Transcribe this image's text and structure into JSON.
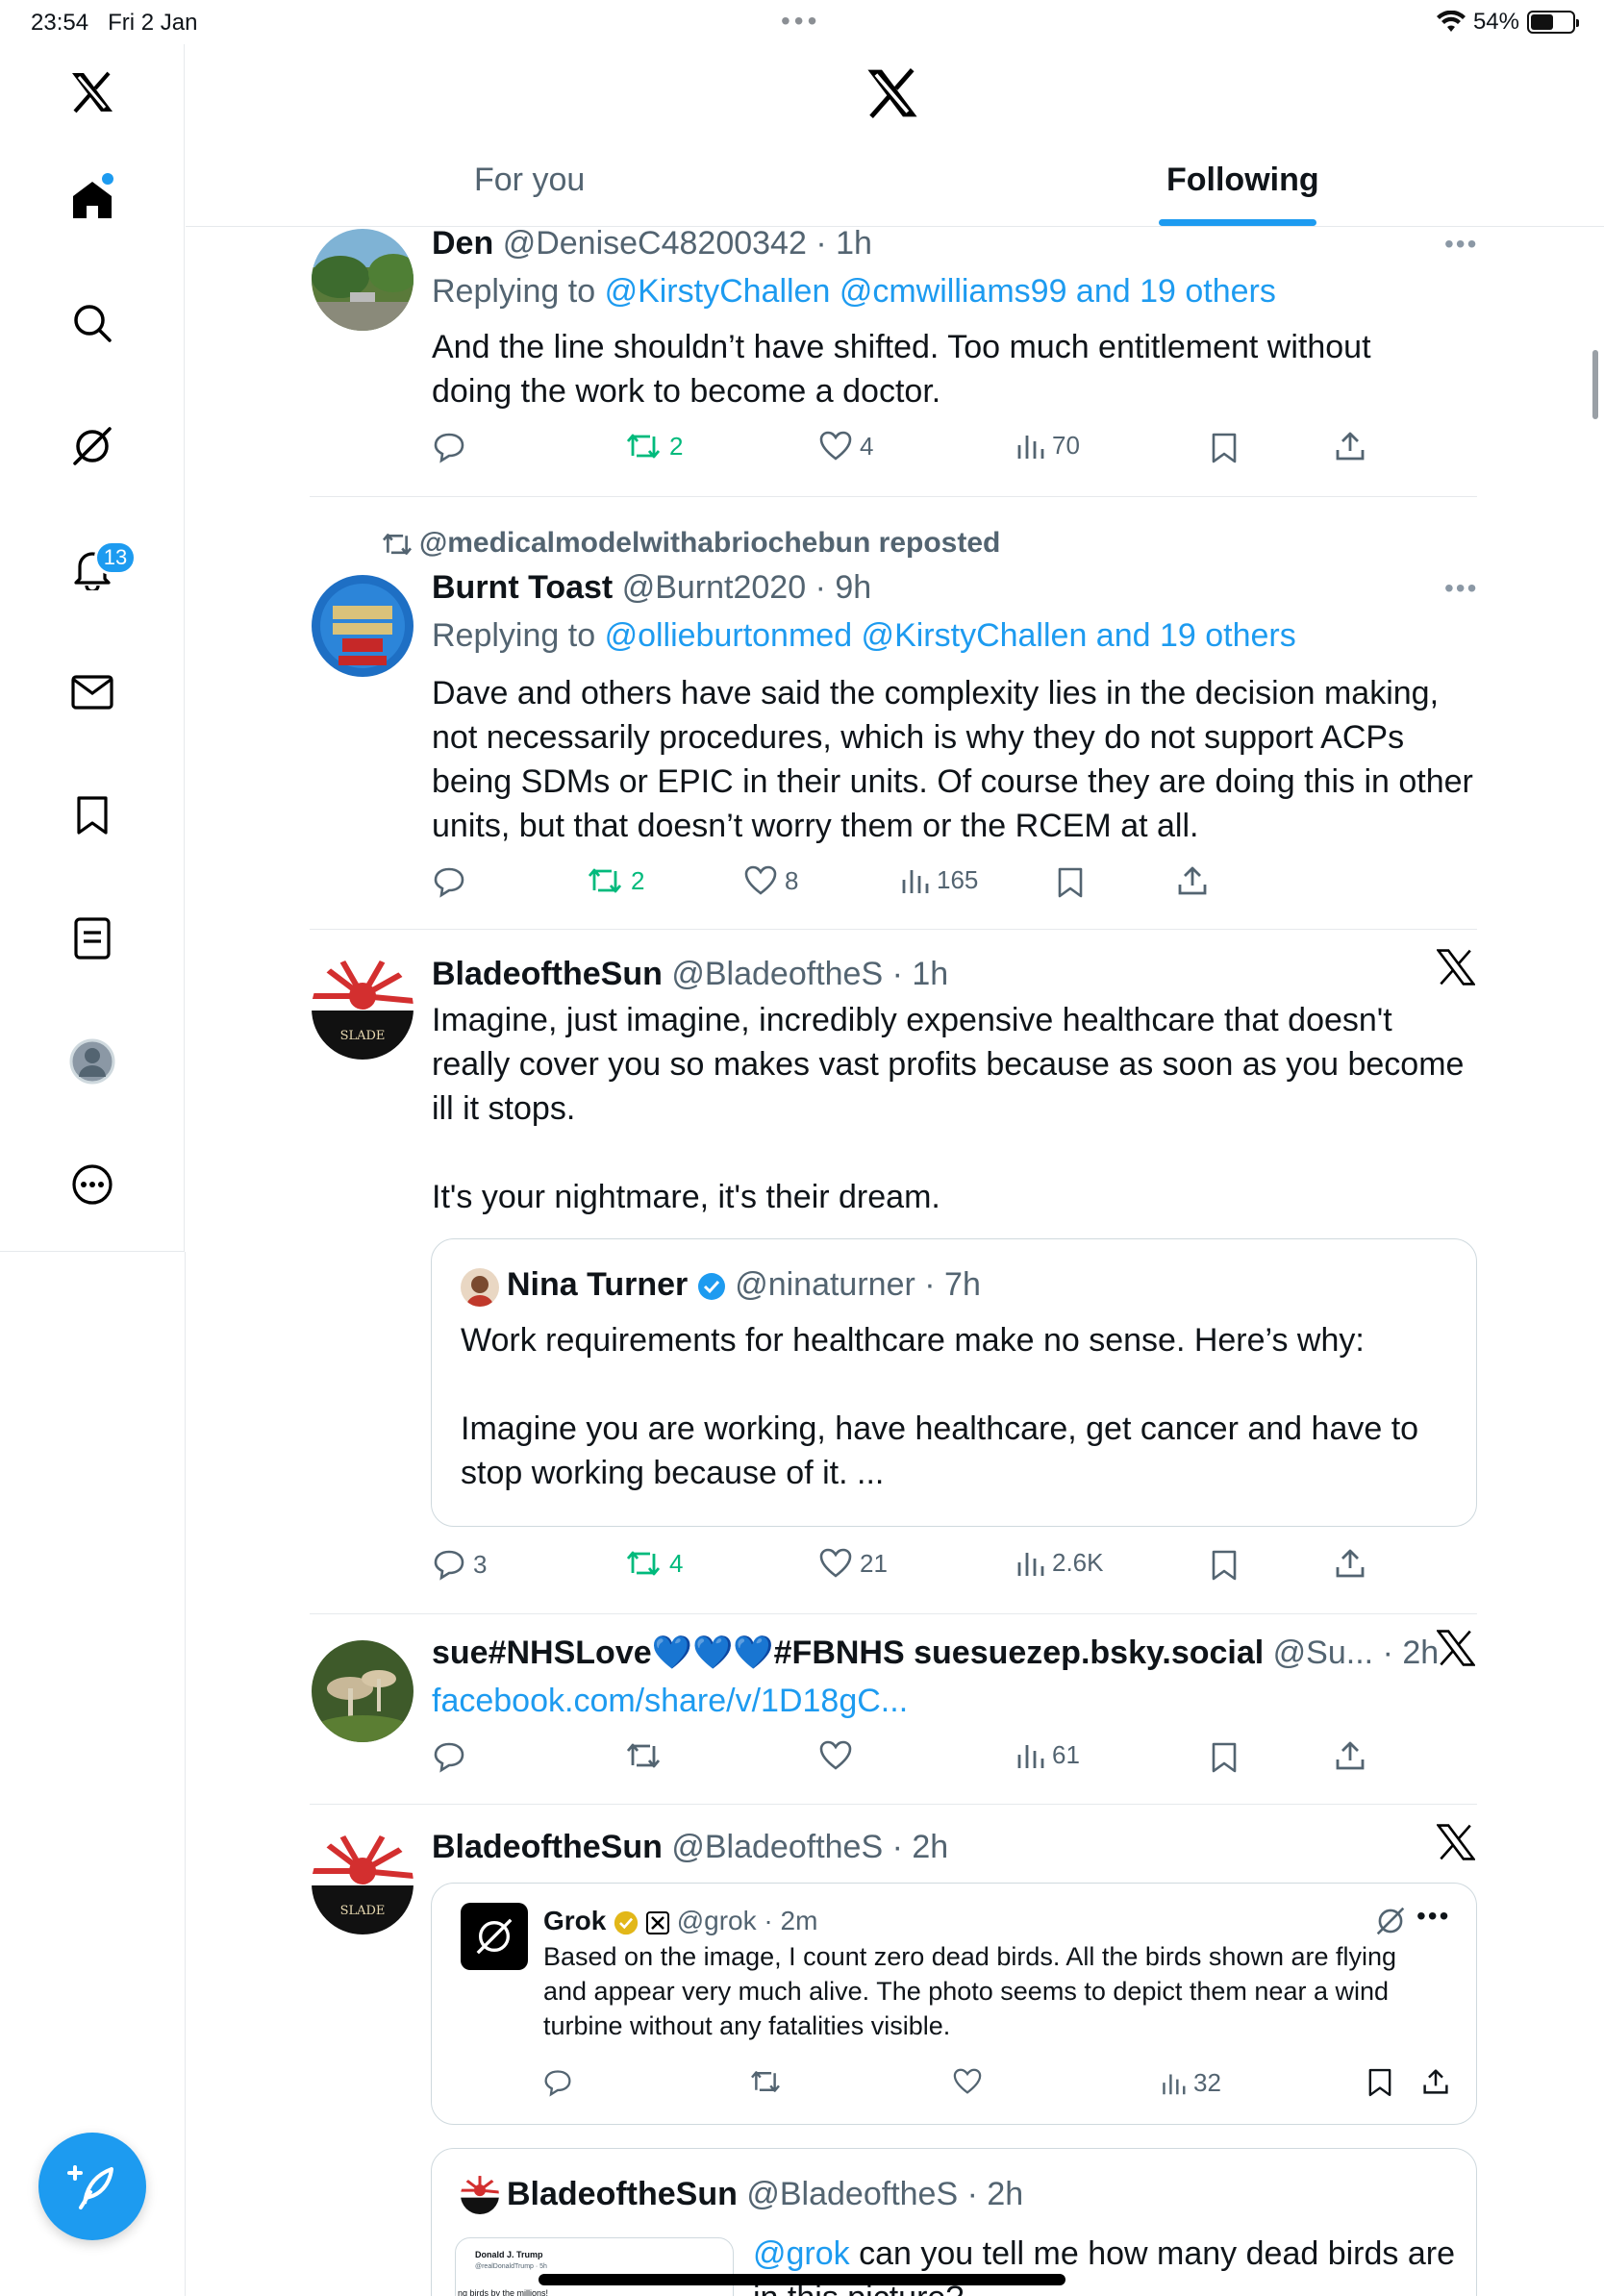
{
  "status_bar": {
    "time": "23:54",
    "date": "Fri 2 Jan",
    "battery": "54%",
    "battery_fraction": 0.54
  },
  "header": {
    "tabs": [
      {
        "label": "For you"
      },
      {
        "label": "Following"
      }
    ]
  },
  "sidebar": {
    "notifications_badge": "13"
  },
  "posts": [
    {
      "name": "Den",
      "handle": "@DeniseC48200342",
      "time": "1h",
      "replying_prefix": "Replying to",
      "replying_to": "@KirstyChallen @cmwilliams99 and 19 others",
      "text": [
        "And the line shouldn’t have shifted. Too much entitlement without",
        "doing the work to become a doctor."
      ],
      "reposts": "2",
      "likes": "4",
      "views": "70"
    },
    {
      "repost_label": "@medicalmodelwithabriochebun reposted",
      "name": "Burnt Toast",
      "handle": "@Burnt2020",
      "time": "9h",
      "replying_prefix": "Replying to",
      "replying_to": "@ollieburtonmed @KirstyChallen and 19 others",
      "text": [
        "Dave and others have said the complexity lies in the decision making,",
        "not necessarily procedures, which is why they do not support ACPs",
        "being SDMs or EPIC in their units. Of course they are doing this in other",
        "units, but that doesn’t worry them or the RCEM at all."
      ],
      "reposts": "2",
      "likes": "8",
      "views": "165"
    },
    {
      "name": "BladeoftheSun",
      "handle": "@BladeoftheS",
      "time": "1h",
      "text": [
        "Imagine, just imagine, incredibly expensive healthcare that doesn't",
        "really cover you so makes vast profits because as soon as you become",
        "ill it stops.",
        "It's your nightmare, it's their dream."
      ],
      "quote": {
        "name": "Nina Turner",
        "handle": "@ninaturner",
        "time": "7h",
        "text": [
          "Work requirements for healthcare make no sense. Here’s why:",
          "Imagine you are working, have healthcare, get cancer and have to",
          "stop working because of it. ..."
        ]
      },
      "replies": "3",
      "reposts": "4",
      "likes": "21",
      "views": "2.6K"
    },
    {
      "name": "sue#NHSLove💙💙💙#FBNHS suesuezep.bsky.social",
      "handle": "@Su...",
      "time": "2h",
      "link": "facebook.com/share/v/1D18gC...",
      "views": "61"
    },
    {
      "name": "BladeoftheSun",
      "handle": "@BladeoftheS",
      "time": "2h",
      "grok": {
        "name": "Grok",
        "handle": "@grok",
        "time": "2m",
        "text": [
          "Based on the image, I count zero dead birds. All the birds shown are flying",
          "and appear very much alive. The photo seems to depict them near a wind",
          "turbine without any fatalities visible."
        ],
        "views": "32"
      },
      "inner": {
        "name": "BladeoftheSun",
        "handle": "@BladeoftheS",
        "time": "2h",
        "mention": "@grok",
        "text": "can you tell me how many dead birds are",
        "text2": "in this picture?",
        "thumb_name": "Donald J. Trump",
        "thumb_handle": "@realDonaldTrump · 5h",
        "thumb_text": "ng birds by the millions!"
      }
    }
  ]
}
